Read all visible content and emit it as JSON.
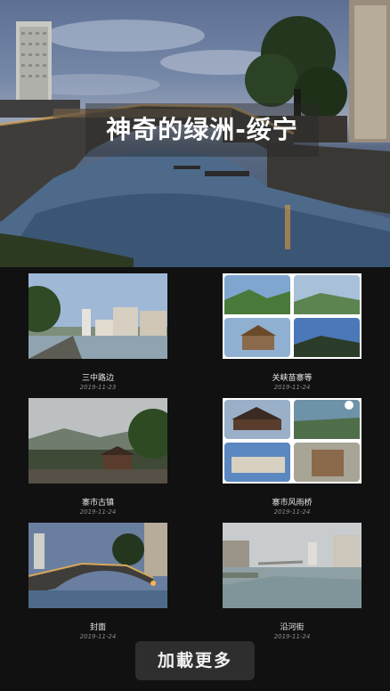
{
  "hero": {
    "title": "神奇的绿洲-绥宁"
  },
  "articles": [
    {
      "title": "三中路边",
      "date": "2019-11-23"
    },
    {
      "title": "关峡苗寨等",
      "date": "2019-11-24"
    },
    {
      "title": "寨市古镇",
      "date": "2019-11-24"
    },
    {
      "title": "寨市风雨桥",
      "date": "2019-11-24"
    },
    {
      "title": "封面",
      "date": "2019-11-24"
    },
    {
      "title": "沿河街",
      "date": "2019-11-24"
    }
  ],
  "load_more": {
    "label": "加載更多"
  },
  "colors": {
    "background": "#111111",
    "button": "#2e2e2e",
    "title_text": "#e8e8e8",
    "date_text": "#8a8a8a"
  }
}
